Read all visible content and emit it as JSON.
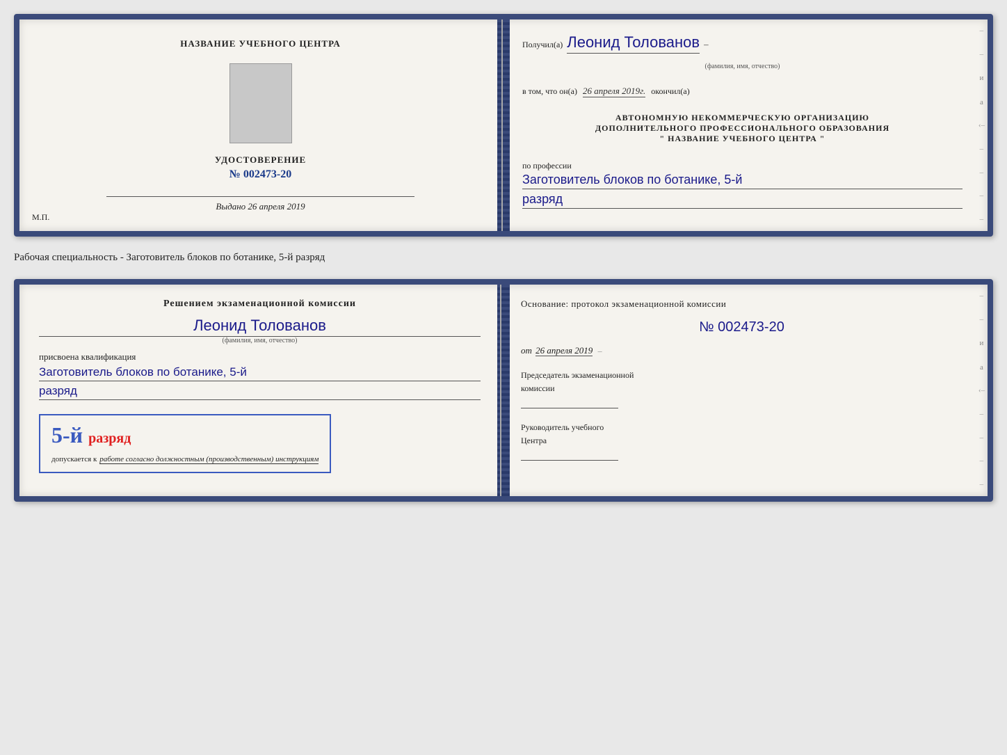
{
  "doc1": {
    "left": {
      "title": "НАЗВАНИЕ УЧЕБНОГО ЦЕНТРА",
      "cert_title": "УДОСТОВЕРЕНИЕ",
      "cert_number": "№ 002473-20",
      "issued_label": "Выдано",
      "issued_date": "26 апреля 2019",
      "mp": "М.П."
    },
    "right": {
      "received_prefix": "Получил(а)",
      "name_handwritten": "Леонид Толованов",
      "name_subtitle": "(фамилия, имя, отчество)",
      "certifies_prefix": "в том, что он(а)",
      "date_handwritten": "26 апреля 2019г.",
      "certifies_suffix": "окончил(а)",
      "org_line1": "АВТОНОМНУЮ НЕКОММЕРЧЕСКУЮ ОРГАНИЗАЦИЮ",
      "org_line2": "ДОПОЛНИТЕЛЬНОГО ПРОФЕССИОНАЛЬНОГО ОБРАЗОВАНИЯ",
      "org_line3": "\"  НАЗВАНИЕ УЧЕБНОГО ЦЕНТРА  \"",
      "profession_label": "по профессии",
      "profession_handwritten": "Заготовитель блоков по ботанике, 5-й",
      "grade_handwritten": "разряд"
    }
  },
  "specialty_label": "Рабочая специальность - Заготовитель блоков по ботанике, 5-й разряд",
  "doc2": {
    "left": {
      "decision_text": "Решением экзаменационной комиссии",
      "name_handwritten": "Леонид Толованов",
      "name_subtitle": "(фамилия, имя, отчество)",
      "qualification_label": "присвоена квалификация",
      "qualification_handwritten": "Заготовитель блоков по ботанике, 5-й",
      "grade_handwritten": "разряд",
      "grade_number": "5-й",
      "grade_suffix": "разряд",
      "допускается_text": "допускается к",
      "допускается_italic": "работе согласно должностным (производственным) инструкциям"
    },
    "right": {
      "basis_text": "Основание: протокол экзаменационной комиссии",
      "protocol_number": "№  002473-20",
      "date_prefix": "от",
      "date_value": "26 апреля 2019",
      "chairman_label1": "Председатель экзаменационной",
      "chairman_label2": "комиссии",
      "director_label1": "Руководитель учебного",
      "director_label2": "Центра"
    }
  }
}
